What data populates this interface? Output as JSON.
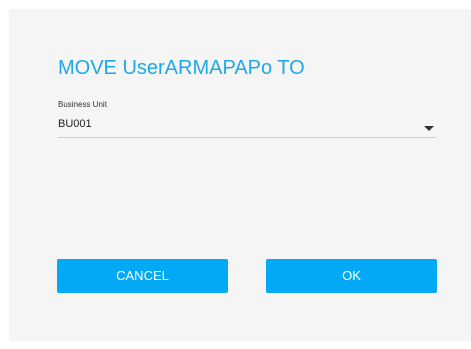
{
  "dialog": {
    "title": "MOVE UserARMAPAPo TO",
    "business_unit": {
      "label": "Business Unit",
      "value": "BU001"
    },
    "buttons": {
      "cancel": "CANCEL",
      "ok": "OK"
    }
  },
  "colors": {
    "accent": "#03a9f4",
    "title": "#20a8e6",
    "background": "#f5f5f5"
  }
}
